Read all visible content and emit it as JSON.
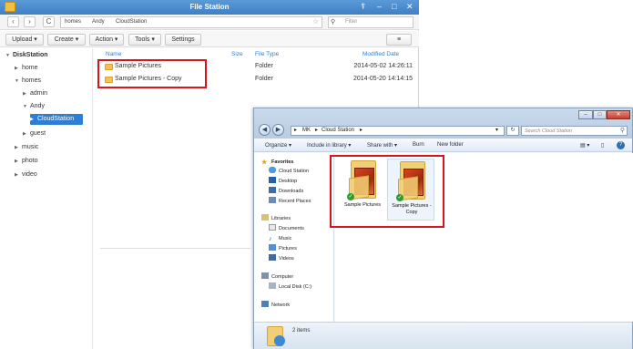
{
  "file_station": {
    "title": "File Station",
    "nav": {
      "back": "‹",
      "forward": "›",
      "refresh": "C",
      "path": [
        "homes",
        "Andy",
        "CloudStation"
      ],
      "star": "☆",
      "search_icon": "⚲",
      "search_placeholder": "Filter"
    },
    "window_controls": {
      "pin": "⍒",
      "minimize": "–",
      "maximize": "□",
      "close": "✕"
    },
    "toolbar": {
      "upload": "Upload ▾",
      "create": "Create ▾",
      "action": "Action ▾",
      "tools": "Tools ▾",
      "settings": "Settings",
      "view": "≡"
    },
    "tree": {
      "root": "DiskStation",
      "home": "home",
      "homes": "homes",
      "admin": "admin",
      "andy": "Andy",
      "cloudstation": "CloudStation",
      "guest": "guest",
      "music": "music",
      "photo": "photo",
      "video": "video"
    },
    "columns": {
      "name": "Name",
      "size": "Size",
      "type": "File Type",
      "modified": "Modified Date"
    },
    "files": [
      {
        "name": "Sample Pictures",
        "type": "Folder",
        "modified": "2014-05-02 14:26:11"
      },
      {
        "name": "Sample Pictures - Copy",
        "type": "Folder",
        "modified": "2014-05-20 14:14:15"
      }
    ]
  },
  "explorer": {
    "address": [
      "MK",
      "Cloud Station"
    ],
    "address_prefix": "▸",
    "search_placeholder": "Search Cloud Station",
    "window_controls": {
      "minimize": "–",
      "maximize": "□",
      "close": "✕"
    },
    "commands": {
      "organize": "Organize ▾",
      "include": "Include in library ▾",
      "share": "Share with ▾",
      "burn": "Burn",
      "new_folder": "New folder"
    },
    "view_buttons": {
      "views": "▤ ▾",
      "preview": "▯",
      "help": "?"
    },
    "nav": {
      "favorites": "Favorites",
      "cloud_station": "Cloud Station",
      "desktop": "Desktop",
      "downloads": "Downloads",
      "recent": "Recent Places",
      "libraries": "Libraries",
      "documents": "Documents",
      "music": "Music",
      "pictures": "Pictures",
      "videos": "Videos",
      "computer": "Computer",
      "local_disk": "Local Disk (C:)",
      "network": "Network"
    },
    "items": [
      {
        "label": "Sample Pictures"
      },
      {
        "label": "Sample Pictures - Copy"
      }
    ],
    "status": "2 items"
  }
}
